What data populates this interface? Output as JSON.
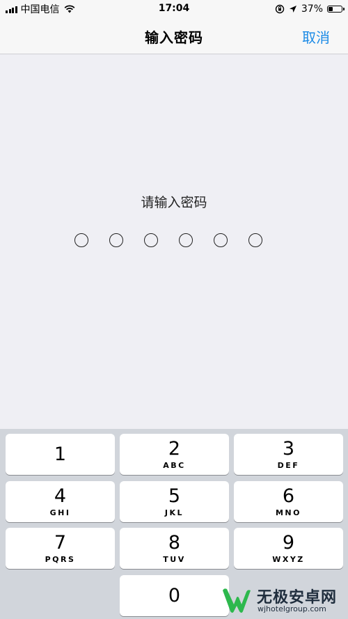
{
  "status_bar": {
    "carrier": "中国电信",
    "time": "17:04",
    "battery": "37%",
    "battery_level": 0.37
  },
  "nav": {
    "title": "输入密码",
    "cancel": "取消"
  },
  "prompt": "请输入密码",
  "passcode_length": 6,
  "keys": [
    {
      "digit": "1",
      "letters": ""
    },
    {
      "digit": "2",
      "letters": "ABC"
    },
    {
      "digit": "3",
      "letters": "DEF"
    },
    {
      "digit": "4",
      "letters": "GHI"
    },
    {
      "digit": "5",
      "letters": "JKL"
    },
    {
      "digit": "6",
      "letters": "MNO"
    },
    {
      "digit": "7",
      "letters": "PQRS"
    },
    {
      "digit": "8",
      "letters": "TUV"
    },
    {
      "digit": "9",
      "letters": "WXYZ"
    },
    {
      "digit": "0",
      "letters": ""
    }
  ],
  "watermark": {
    "title": "无极安卓网",
    "url": "wjhotelgroup.com"
  },
  "colors": {
    "accent": "#1a8ae6",
    "background": "#efeff4",
    "keypad_bg": "#d1d5db",
    "watermark_green": "#2db84d"
  }
}
